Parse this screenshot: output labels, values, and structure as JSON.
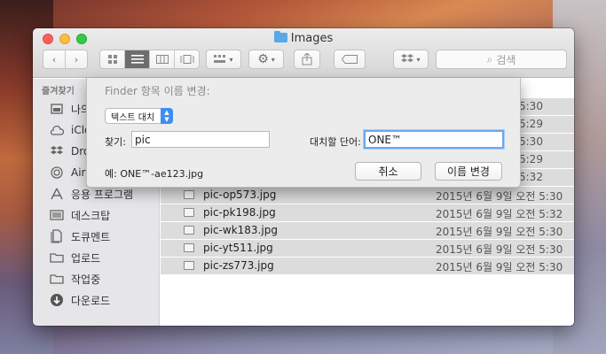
{
  "window": {
    "title": "Images"
  },
  "toolbar": {
    "search_placeholder": "검색"
  },
  "sidebar": {
    "heading": "즐겨찾기",
    "items": [
      {
        "label": "나의",
        "icon": "all-files-icon"
      },
      {
        "label": "iClo",
        "icon": "cloud-icon"
      },
      {
        "label": "Dro",
        "icon": "dropbox-icon"
      },
      {
        "label": "Airl",
        "icon": "airdrop-icon"
      },
      {
        "label": "응용 프로그램",
        "icon": "applications-icon"
      },
      {
        "label": "데스크탑",
        "icon": "desktop-icon"
      },
      {
        "label": "도큐멘트",
        "icon": "documents-icon"
      },
      {
        "label": "업로드",
        "icon": "folder-icon"
      },
      {
        "label": "작업중",
        "icon": "folder-icon"
      },
      {
        "label": "다운로드",
        "icon": "downloads-icon"
      }
    ]
  },
  "files": [
    {
      "name": "",
      "date": "5:30",
      "selected": true
    },
    {
      "name": "",
      "date": "5:29",
      "selected": true
    },
    {
      "name": "",
      "date": "5:30",
      "selected": true
    },
    {
      "name": "",
      "date": "5:29",
      "selected": true
    },
    {
      "name": "",
      "date": "5:32",
      "selected": true
    },
    {
      "name": "pic-op573.jpg",
      "date": "2015년 6월 9일 오전 5:30",
      "selected": true
    },
    {
      "name": "pic-pk198.jpg",
      "date": "2015년 6월 9일 오전 5:32",
      "selected": true
    },
    {
      "name": "pic-wk183.jpg",
      "date": "2015년 6월 9일 오전 5:30",
      "selected": true
    },
    {
      "name": "pic-yt511.jpg",
      "date": "2015년 6월 9일 오전 5:30",
      "selected": true
    },
    {
      "name": "pic-zs773.jpg",
      "date": "2015년 6월 9일 오전 5:30",
      "selected": true
    }
  ],
  "rename_sheet": {
    "title": "Finder 항목 이름 변경:",
    "mode_select": "텍스트 대치",
    "find_label": "찾기:",
    "find_value": "pic",
    "replace_label": "대치할 단어:",
    "replace_value": "ONE™",
    "example": "예: ONE™-ae123.jpg",
    "cancel_label": "취소",
    "rename_label": "이름 변경"
  }
}
